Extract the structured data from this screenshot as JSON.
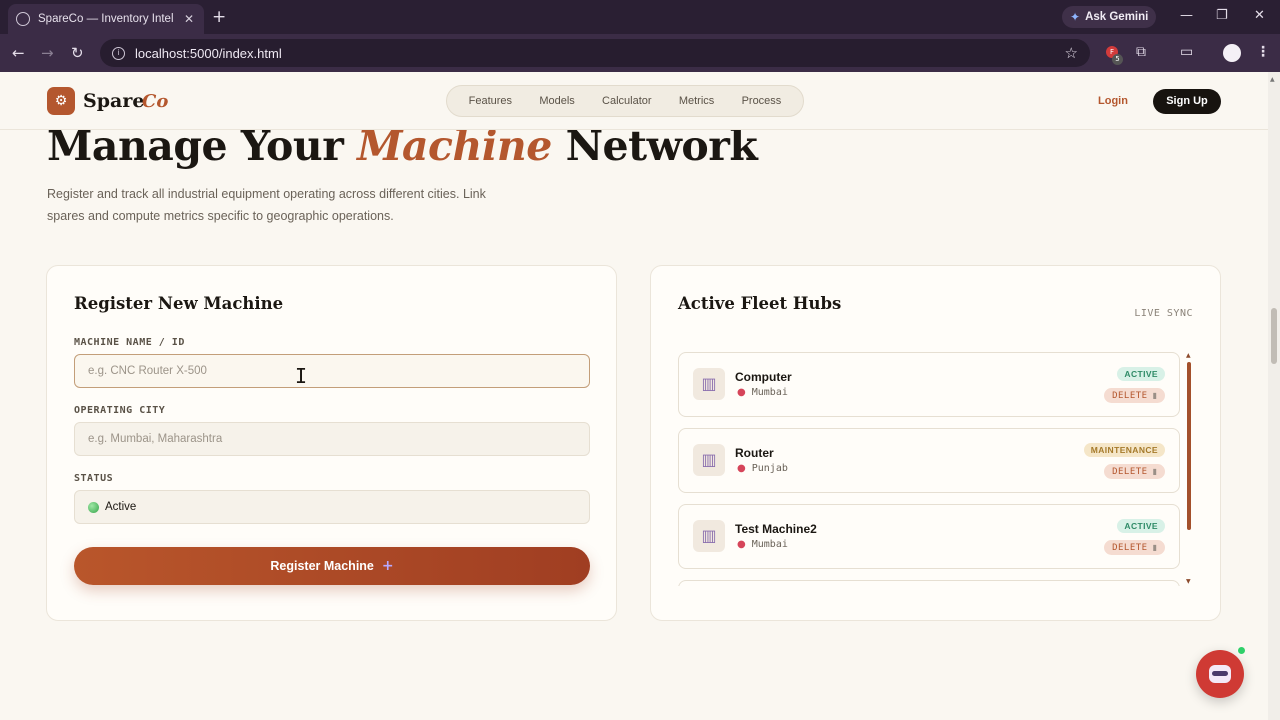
{
  "browser": {
    "tab_title": "SpareCo — Inventory Intelligen",
    "new_tab": "+",
    "ask_gemini": "Ask Gemini",
    "url": "localhost:5000/index.html",
    "ext_badge": "F",
    "ext_count": "5"
  },
  "header": {
    "logo_word": "Spare",
    "logo_accent": "Co",
    "nav": [
      "Features",
      "Models",
      "Calculator",
      "Metrics",
      "Process"
    ],
    "login": "Login",
    "signup": "Sign Up"
  },
  "hero": {
    "title_pre": "Manage Your ",
    "title_accent": "Machine",
    "title_post": " Network",
    "description": "Register and track all industrial equipment operating across different cities. Link spares and compute metrics specific to geographic operations."
  },
  "register": {
    "title": "Register New Machine",
    "name_label": "MACHINE NAME / ID",
    "name_placeholder": "e.g. CNC Router X-500",
    "city_label": "OPERATING CITY",
    "city_placeholder": "e.g. Mumbai, Maharashtra",
    "status_label": "STATUS",
    "status_value": "Active",
    "button_label": "Register Machine",
    "button_icon": "+"
  },
  "fleet": {
    "title": "Active Fleet Hubs",
    "live_sync": "LIVE SYNC",
    "delete_label": "DELETE",
    "hubs": [
      {
        "name": "Computer",
        "city": "Mumbai",
        "status": "ACTIVE"
      },
      {
        "name": "Router",
        "city": "Punjab",
        "status": "MAINTENANCE"
      },
      {
        "name": "Test Machine2",
        "city": "Mumbai",
        "status": "ACTIVE"
      }
    ]
  },
  "colors": {
    "accent": "#b4572e",
    "active_badge": "#2e8a66",
    "maintenance_badge": "#a57a2a",
    "chat_bot": "#cf3a34"
  },
  "icons": {
    "logo": "gear-icon",
    "hub": "factory-icon",
    "location": "pin-icon",
    "delete": "trash-icon",
    "chat": "robot-icon"
  }
}
